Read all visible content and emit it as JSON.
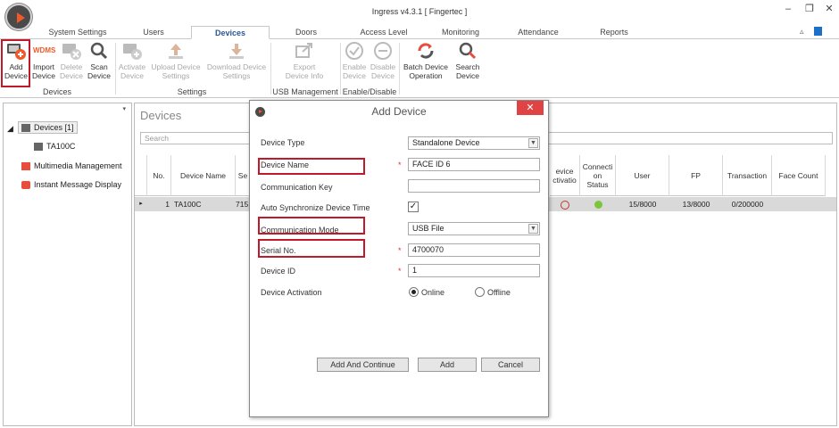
{
  "window": {
    "title": "Ingress v4.3.1 [ Fingertec ]",
    "controls": [
      "–",
      "❐",
      "✕"
    ]
  },
  "tabs": [
    "System Settings",
    "Users",
    "Devices",
    "Doors",
    "Access Level",
    "Monitoring",
    "Attendance",
    "Reports"
  ],
  "active_tab": "Devices",
  "ribbon": {
    "add_device": [
      "Add",
      "Device"
    ],
    "wdms": "WDMS",
    "import_device": [
      "Import",
      "Device"
    ],
    "delete_device": [
      "Delete",
      "Device"
    ],
    "scan_device": [
      "Scan",
      "Device"
    ],
    "activate_device": [
      "Activate",
      "Device"
    ],
    "upload_settings": [
      "Upload Device",
      "Settings"
    ],
    "download_settings": [
      "Download Device",
      "Settings"
    ],
    "export_info": [
      "Export",
      "Device Info"
    ],
    "enable_device": [
      "Enable",
      "Device"
    ],
    "disable_device": [
      "Disable",
      "Device"
    ],
    "batch_operation": [
      "Batch Device",
      "Operation"
    ],
    "search_device": [
      "Search",
      "Device"
    ],
    "groups": [
      "Devices",
      "Settings",
      "USB Management",
      "Enable/Disable"
    ]
  },
  "sidebar": {
    "pin": "📌",
    "items": [
      "Devices [1]",
      "TA100C",
      "Multimedia Management",
      "Instant Message Display"
    ]
  },
  "main": {
    "title": "Devices",
    "search_placeholder": "Search",
    "columns": [
      "No.",
      "Device Name",
      "Se",
      "evice\nctivatio",
      "Connecti\non\nStatus",
      "User",
      "FP",
      "Transaction",
      "Face Count"
    ],
    "row": {
      "no": "1",
      "name": "TA100C",
      "serial": "715",
      "user": "15/8000",
      "fp": "13/8000",
      "transaction": "0/200000"
    },
    "status_color": "#7dc63b"
  },
  "dialog": {
    "title": "Add Device",
    "close": "✕",
    "fields": {
      "device_type_label": "Device Type",
      "device_type_value": "Standalone Device",
      "device_name_label": "Device Name",
      "device_name_value": "FACE ID 6",
      "comm_key_label": "Communication Key",
      "comm_key_value": "",
      "auto_sync_label": "Auto Synchronize Device Time",
      "auto_sync_checked": "✓",
      "comm_mode_label": "Communication Mode",
      "comm_mode_value": "USB File",
      "serial_label": "Serial No.",
      "serial_value": "4700070",
      "device_id_label": "Device ID",
      "device_id_value": "1",
      "activation_label": "Device Activation",
      "online": "Online",
      "offline": "Offline",
      "required": "*"
    },
    "buttons": {
      "add_continue": "Add And Continue",
      "add": "Add",
      "cancel": "Cancel"
    }
  },
  "colors": {
    "accent": "#2b5797",
    "highlight": "#c0192b",
    "brand": "#f05a28",
    "close_red": "#e04343"
  }
}
